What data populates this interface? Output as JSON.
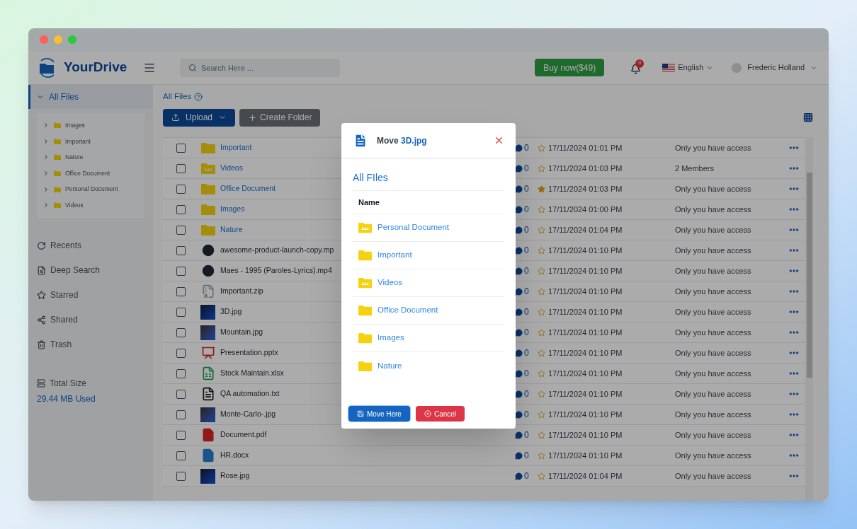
{
  "header": {
    "brand": "YourDrive",
    "search": {
      "placeholder": "Search Here ..."
    },
    "buy_button": "Buy now($49)",
    "notifications": {
      "count": "0"
    },
    "language": "English",
    "user": "Frederic Holland"
  },
  "sidebar": {
    "root": {
      "label": "All Files",
      "selected": true,
      "expanded": true,
      "children": [
        {
          "label": "Images",
          "expanded": false
        },
        {
          "label": "Important",
          "expanded": false
        },
        {
          "label": "Nature",
          "expanded": false
        },
        {
          "label": "Office Document",
          "expanded": false
        },
        {
          "label": "Personal Document",
          "expanded": false
        },
        {
          "label": "Videos",
          "expanded": false
        }
      ]
    },
    "nav": [
      {
        "label": "Recents",
        "kind": "recent",
        "selected": false
      },
      {
        "label": "Deep Search",
        "kind": "search",
        "selected": false
      },
      {
        "label": "Starred",
        "kind": "star",
        "selected": false
      },
      {
        "label": "Shared",
        "kind": "share",
        "selected": false
      },
      {
        "label": "Trash",
        "kind": "trash",
        "selected": false
      }
    ],
    "storage": {
      "label": "Total Size",
      "used": "29.44 MB Used"
    }
  },
  "main": {
    "breadcrumb": "All Files",
    "upload_button": "Upload",
    "create_button": "Create Folder",
    "rows": [
      {
        "name": "Important",
        "kind": "folder",
        "checked": false,
        "comments": "0",
        "starred": false,
        "date": "17/11/2024 01:01 PM",
        "access": "Only you have access"
      },
      {
        "name": "Videos",
        "kind": "shared-folder",
        "checked": false,
        "comments": "0",
        "starred": false,
        "date": "17/11/2024 01:03 PM",
        "access": "2 Members"
      },
      {
        "name": "Office Document",
        "kind": "folder",
        "checked": false,
        "comments": "0",
        "starred": true,
        "date": "17/11/2024 01:03 PM",
        "access": "Only you have access"
      },
      {
        "name": "Images",
        "kind": "folder",
        "checked": false,
        "comments": "0",
        "starred": false,
        "date": "17/11/2024 01:00 PM",
        "access": "Only you have access"
      },
      {
        "name": "Nature",
        "kind": "folder",
        "checked": false,
        "comments": "0",
        "starred": false,
        "date": "17/11/2024 01:04 PM",
        "access": "Only you have access"
      },
      {
        "name": "awesome-product-launch-copy.mp",
        "kind": "video",
        "checked": false,
        "comments": "0",
        "starred": false,
        "date": "17/11/2024 01:10 PM",
        "access": "Only you have access"
      },
      {
        "name": "Maes - 1995 (Paroles-Lyrics).mp4",
        "kind": "video",
        "checked": false,
        "comments": "0",
        "starred": false,
        "date": "17/11/2024 01:10 PM",
        "access": "Only you have access"
      },
      {
        "name": "Important.zip",
        "kind": "zip",
        "checked": false,
        "comments": "0",
        "starred": false,
        "date": "17/11/2024 01:10 PM",
        "access": "Only you have access"
      },
      {
        "name": "3D.jpg",
        "kind": "image",
        "checked": false,
        "comments": "0",
        "starred": false,
        "date": "17/11/2024 01:10 PM",
        "access": "Only you have access"
      },
      {
        "name": "Mountain.jpg",
        "kind": "image",
        "checked": false,
        "comments": "0",
        "starred": false,
        "date": "17/11/2024 01:10 PM",
        "access": "Only you have access"
      },
      {
        "name": "Presentation.pptx",
        "kind": "slides",
        "checked": false,
        "comments": "0",
        "starred": false,
        "date": "17/11/2024 01:10 PM",
        "access": "Only you have access"
      },
      {
        "name": "Stock Maintain.xlsx",
        "kind": "sheet",
        "checked": false,
        "comments": "0",
        "starred": false,
        "date": "17/11/2024 01:10 PM",
        "access": "Only you have access"
      },
      {
        "name": "QA automation.txt",
        "kind": "text",
        "checked": false,
        "comments": "0",
        "starred": false,
        "date": "17/11/2024 01:10 PM",
        "access": "Only you have access"
      },
      {
        "name": "Monte-Carlo-.jpg",
        "kind": "image",
        "checked": false,
        "comments": "0",
        "starred": false,
        "date": "17/11/2024 01:10 PM",
        "access": "Only you have access"
      },
      {
        "name": "Document.pdf",
        "kind": "pdf",
        "checked": false,
        "comments": "0",
        "starred": false,
        "date": "17/11/2024 01:10 PM",
        "access": "Only you have access"
      },
      {
        "name": "HR.docx",
        "kind": "doc",
        "checked": false,
        "comments": "0",
        "starred": false,
        "date": "17/11/2024 01:10 PM",
        "access": "Only you have access"
      },
      {
        "name": "Rose.jpg",
        "kind": "image",
        "checked": false,
        "comments": "0",
        "starred": false,
        "date": "17/11/2024 01:04 PM",
        "access": "Only you have access"
      }
    ]
  },
  "dialog": {
    "title": "Move",
    "file_name": "3D.jpg",
    "location": "All FIles",
    "column": "Name",
    "folders": [
      {
        "name": "Personal Document",
        "kind": "shared-folder"
      },
      {
        "name": "Important",
        "kind": "folder"
      },
      {
        "name": "Videos",
        "kind": "shared-folder"
      },
      {
        "name": "Office Document",
        "kind": "folder"
      },
      {
        "name": "Images",
        "kind": "folder"
      },
      {
        "name": "Nature",
        "kind": "folder"
      }
    ],
    "confirm_button": "Move Here",
    "cancel_button": "Cancel"
  }
}
